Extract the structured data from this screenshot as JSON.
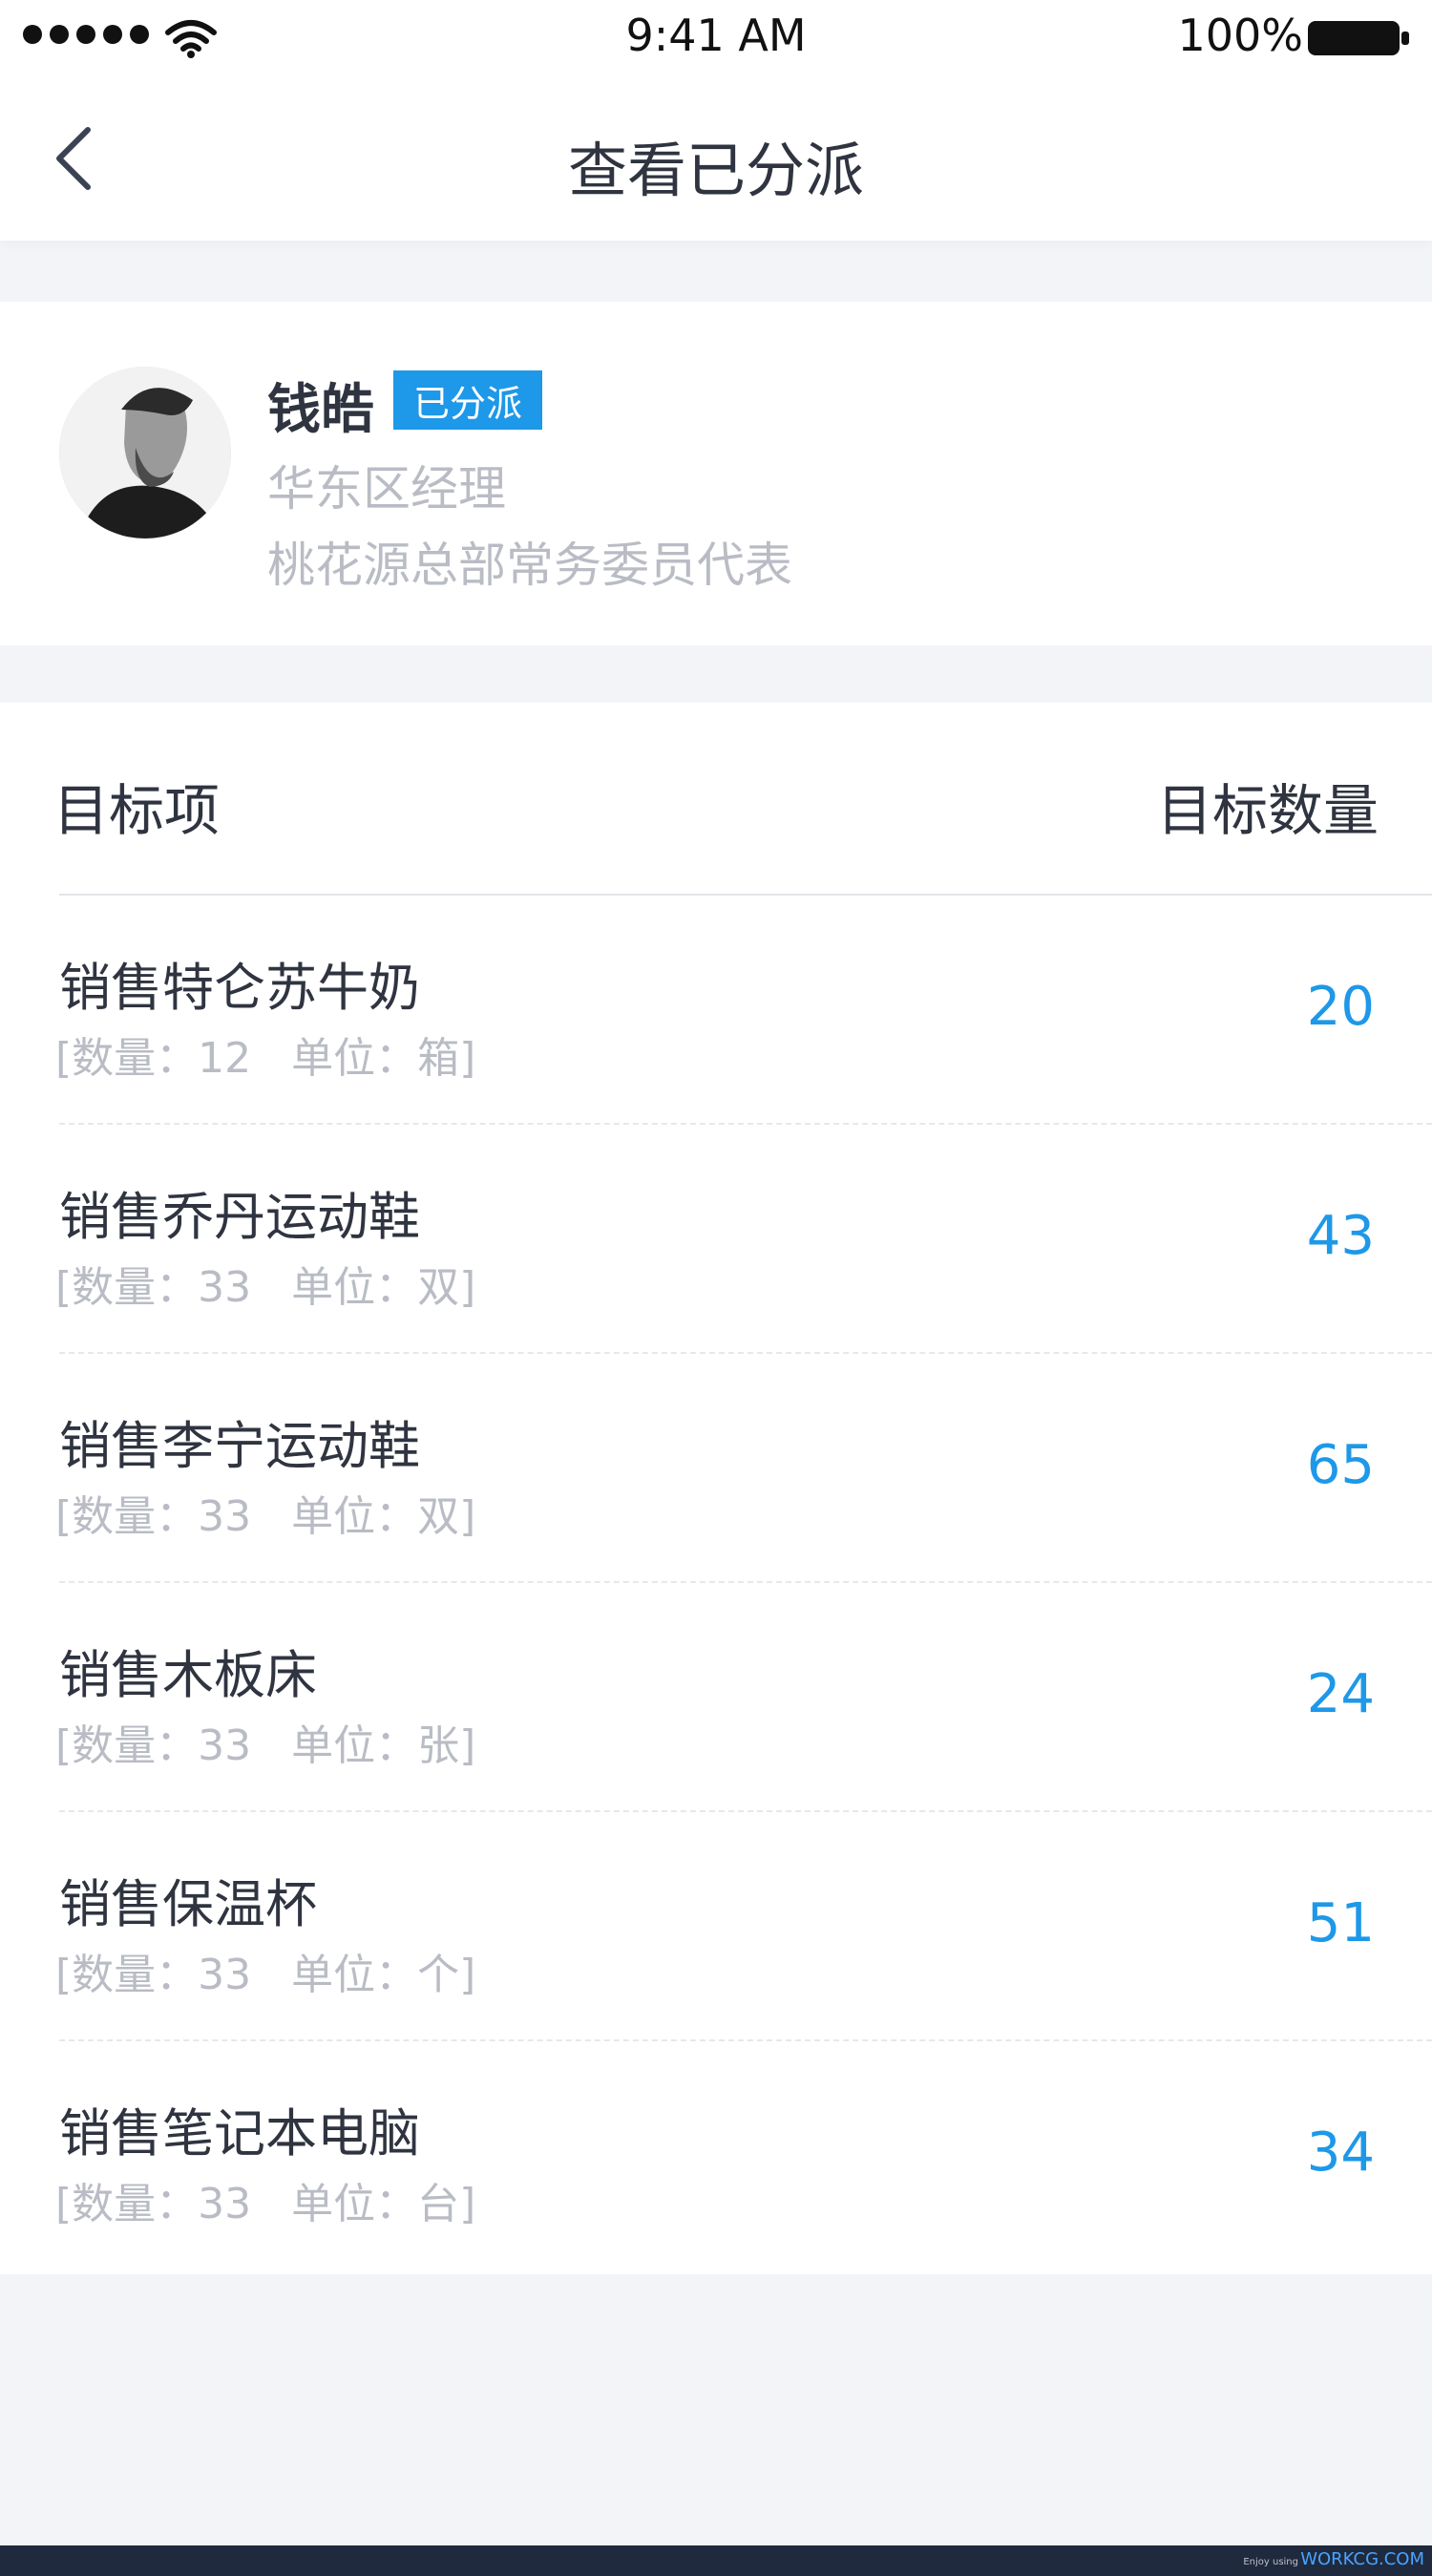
{
  "status_bar": {
    "time": "9:41 AM",
    "battery": "100%"
  },
  "nav": {
    "title": "查看已分派",
    "back_icon": "chevron-left-icon"
  },
  "profile": {
    "name": "钱皓",
    "badge": "已分派",
    "role": "华东区经理",
    "org": "桃花源总部常务委员代表"
  },
  "table": {
    "header_left": "目标项",
    "header_right": "目标数量",
    "rows": [
      {
        "title": "销售特仑苏牛奶",
        "sub": "[数量：12   单位：箱]",
        "value": "20"
      },
      {
        "title": "销售乔丹运动鞋",
        "sub": "[数量：33   单位：双]",
        "value": "43"
      },
      {
        "title": "销售李宁运动鞋",
        "sub": "[数量：33   单位：双]",
        "value": "65"
      },
      {
        "title": "销售木板床",
        "sub": "[数量：33   单位：张]",
        "value": "24"
      },
      {
        "title": "销售保温杯",
        "sub": "[数量：33   单位：个]",
        "value": "51"
      },
      {
        "title": "销售笔记本电脑",
        "sub": "[数量：33   单位：台]",
        "value": "34"
      }
    ]
  },
  "footer": {
    "small_text": "Enjoy using",
    "brand": "WORKCG.COM"
  },
  "colors": {
    "accent": "#1e98e8",
    "text_primary": "#2f3440",
    "text_secondary": "#b9bcc4",
    "background": "#f3f4f8"
  }
}
